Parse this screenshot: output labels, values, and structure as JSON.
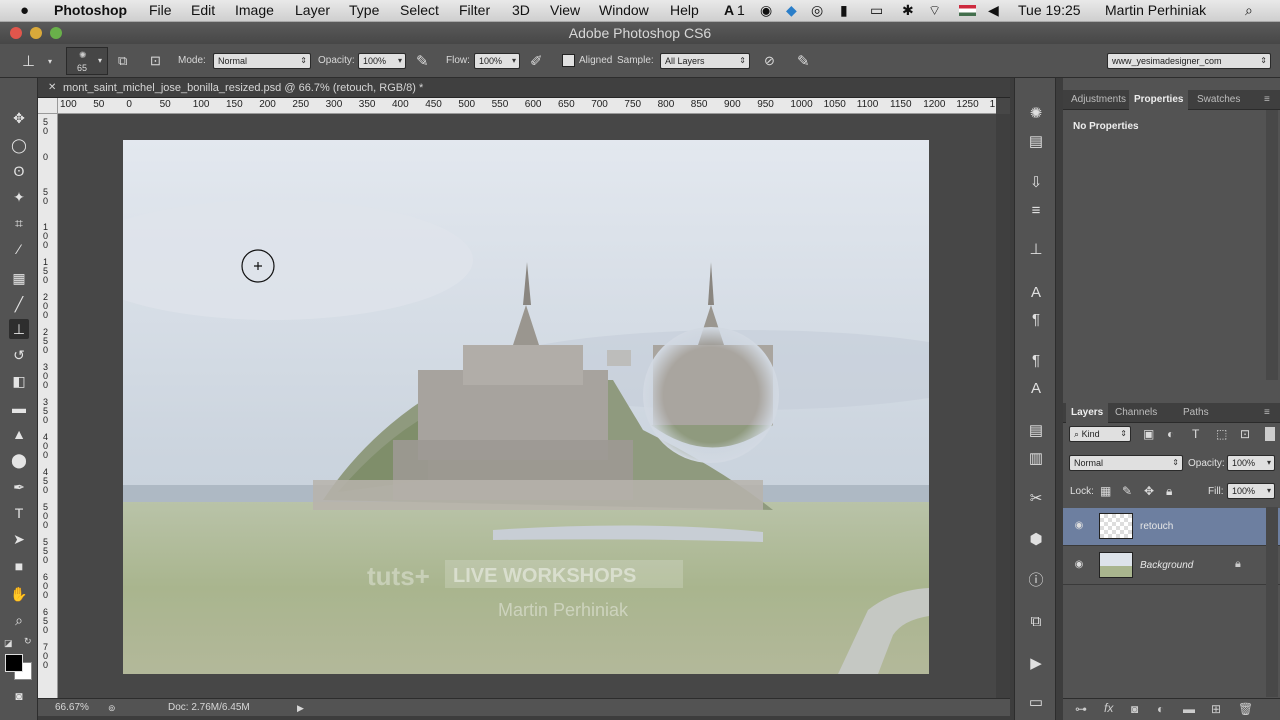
{
  "menubar": {
    "app_name": "Photoshop",
    "items": [
      "File",
      "Edit",
      "Image",
      "Layer",
      "Type",
      "Select",
      "Filter",
      "3D",
      "View",
      "Window",
      "Help"
    ],
    "status_num": "1",
    "clock": "Tue 19:25",
    "user": "Martin Perhiniak"
  },
  "window": {
    "title": "Adobe Photoshop CS6"
  },
  "options": {
    "brush_size": "65",
    "mode_label": "Mode:",
    "mode_value": "Normal",
    "opacity_label": "Opacity:",
    "opacity_value": "100%",
    "flow_label": "Flow:",
    "flow_value": "100%",
    "aligned_label": "Aligned",
    "sample_label": "Sample:",
    "sample_value": "All Layers",
    "workspace": "www_yesimadesigner_com"
  },
  "document": {
    "tab_title": "mont_saint_michel_jose_bonilla_resized.psd @ 66.7% (retouch, RGB/8) *",
    "ruler_h": [
      "100",
      "50",
      "0",
      "50",
      "100",
      "150",
      "200",
      "250",
      "300",
      "350",
      "400",
      "450",
      "500",
      "550",
      "600",
      "650",
      "700",
      "750",
      "800",
      "850",
      "900",
      "950",
      "1000",
      "1050",
      "1100",
      "1150",
      "1200",
      "1250",
      "1"
    ],
    "ruler_v": [
      "5 0",
      "0",
      "5 0",
      "1 0 0",
      "1 5 0",
      "2 0 0",
      "2 5 0",
      "3 0 0",
      "3 5 0",
      "4 0 0",
      "4 5 0",
      "5 0 0",
      "5 5 0",
      "6 0 0",
      "6 5 0",
      "7 0 0"
    ],
    "watermark_brand": "tuts+",
    "watermark_banner": "LIVE WORKSHOPS",
    "watermark_author": "Martin Perhiniak"
  },
  "status": {
    "zoom": "66.67%",
    "doc": "Doc: 2.76M/6.45M"
  },
  "panels": {
    "top_tabs": [
      "Adjustments",
      "Properties",
      "Swatches"
    ],
    "no_properties": "No Properties",
    "layer_tabs": [
      "Layers",
      "Channels",
      "Paths"
    ],
    "kind_label": "Kind",
    "blend_mode": "Normal",
    "opacity_label": "Opacity:",
    "opacity_value": "100%",
    "lock_label": "Lock:",
    "fill_label": "Fill:",
    "fill_value": "100%",
    "layers": [
      {
        "name": "retouch"
      },
      {
        "name": "Background"
      }
    ]
  },
  "colors": {
    "accent_selected_layer": "#6d7fa0",
    "sky": "#cdd6e1",
    "grass": "#a9b58e"
  }
}
